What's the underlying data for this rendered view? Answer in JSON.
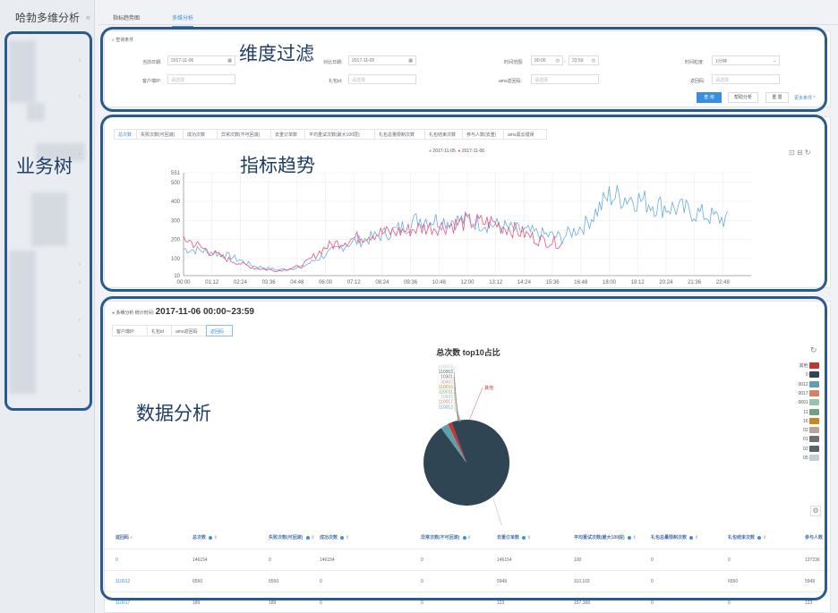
{
  "app": {
    "title": "哈勃多维分析",
    "collapse_icon": "«"
  },
  "tabs": [
    {
      "label": "指标趋势图",
      "active": false
    },
    {
      "label": "多维分析",
      "active": true
    }
  ],
  "overlay_labels": {
    "tree": "业务树",
    "filter": "维度过滤",
    "trend": "指标趋势",
    "analysis": "数据分析"
  },
  "filter": {
    "header": "查询条件",
    "date_label": "当前日期:",
    "date_value": "2017-11-06",
    "compare_label": "对比日期:",
    "compare_value": "2017-11-05",
    "time_label": "时间范围:",
    "time_start": "00:00",
    "time_sep": "-",
    "time_end": "23:59",
    "granularity_label": "时间粒度:",
    "granularity_value": "1分钟",
    "customer_label": "客户端IP:",
    "customer_placeholder": "请选择",
    "package_label": "礼包id:",
    "package_placeholder": "请选择",
    "region_label": "ams返回码:",
    "region_placeholder": "请选择",
    "channel_label": "返回码:",
    "channel_placeholder": "请选择",
    "query_btn": "查 询",
    "help_btn": "帮助分析",
    "reset_btn": "重 置",
    "more_link": "更多条件 ^"
  },
  "metric_tabs": [
    "总次数",
    "失败次数(可回滚)",
    "成功次数",
    "异常次数(不可回滚)",
    "去重订单数",
    "平均重试次数(最大100层)",
    "礼包总量限制次数",
    "礼包结束次数",
    "参与人数(去重)",
    "ams黑云错误"
  ],
  "chart_data": {
    "type": "line",
    "series": [
      {
        "name": "2017-11-05",
        "color": "#6aaae5"
      },
      {
        "name": "2017-11-06",
        "color": "#e8577a"
      }
    ],
    "yticks": [
      "551",
      "500",
      "400",
      "300",
      "200",
      "100",
      "10"
    ],
    "ylim": [
      10,
      551
    ],
    "xticks": [
      "00:00",
      "01:12",
      "02:24",
      "03:36",
      "04:48",
      "06:00",
      "07:12",
      "08:24",
      "09:36",
      "10:48",
      "12:00",
      "13:12",
      "14:24",
      "15:36",
      "16:48",
      "18:00",
      "19:12",
      "20:24",
      "21:36",
      "22:48"
    ],
    "series_0_hourly_values": [
      150,
      140,
      110,
      60,
      40,
      55,
      120,
      180,
      210,
      250,
      310,
      300,
      300,
      280,
      250,
      230,
      210,
      280,
      430,
      420,
      380,
      360,
      330,
      300
    ],
    "series_1_hourly_values": [
      210,
      140,
      90,
      50,
      35,
      60,
      160,
      200,
      230,
      240,
      260,
      270,
      290,
      290,
      250,
      200,
      180
    ]
  },
  "chart_toolbar": {
    "icons": [
      "zoom-icon",
      "zoom-reset-icon",
      "refresh-icon"
    ]
  },
  "analysis": {
    "header_prefix": "多维分析  统计时间:",
    "header_time": "2017-11-06 00:00~23:59",
    "sub_tabs": [
      "客户端IP",
      "礼包id",
      "ams返回码",
      "返回码"
    ],
    "active_sub_tab": 3,
    "pie_title": "总次数  top10占比",
    "pie_labels": [
      "110003",
      "110002",
      "10301",
      "30402",
      "110016",
      "110011",
      "10605",
      "110017",
      "110012",
      "其他",
      "0"
    ],
    "legend": [
      {
        "label": "其他",
        "color": "#c23531"
      },
      {
        "label": "0",
        "color": "#2f4554"
      },
      {
        "label": "0012",
        "color": "#61a0a8"
      },
      {
        "label": "0017",
        "color": "#d48265"
      },
      {
        "label": "0601",
        "color": "#91c7ae"
      },
      {
        "label": "11",
        "color": "#749f83"
      },
      {
        "label": "16",
        "color": "#ca8622"
      },
      {
        "label": "02",
        "color": "#bda29a"
      },
      {
        "label": "01",
        "color": "#6e7074"
      },
      {
        "label": "02",
        "color": "#546570"
      },
      {
        "label": "05",
        "color": "#c4ccd3"
      }
    ],
    "table": {
      "headers": [
        "返回码",
        "总次数",
        "失败次数(可回滚)",
        "成功次数",
        "异常次数(不可回滚)",
        "去重订单数",
        "平均重试次数(最大100层)",
        "礼包总量限制次数",
        "礼包结束次数",
        "参与人数"
      ],
      "rows": [
        [
          "0",
          "146154",
          "0",
          "146154",
          "0",
          "146154",
          "100",
          "0",
          "0",
          "137236"
        ],
        [
          "110012",
          "6550",
          "6550",
          "0",
          "0",
          "5949",
          "110.103",
          "0",
          "6550",
          "5949"
        ],
        [
          "110017",
          "189",
          "189",
          "0",
          "0",
          "123",
          "157.368",
          "0",
          "0",
          "123"
        ]
      ]
    }
  }
}
